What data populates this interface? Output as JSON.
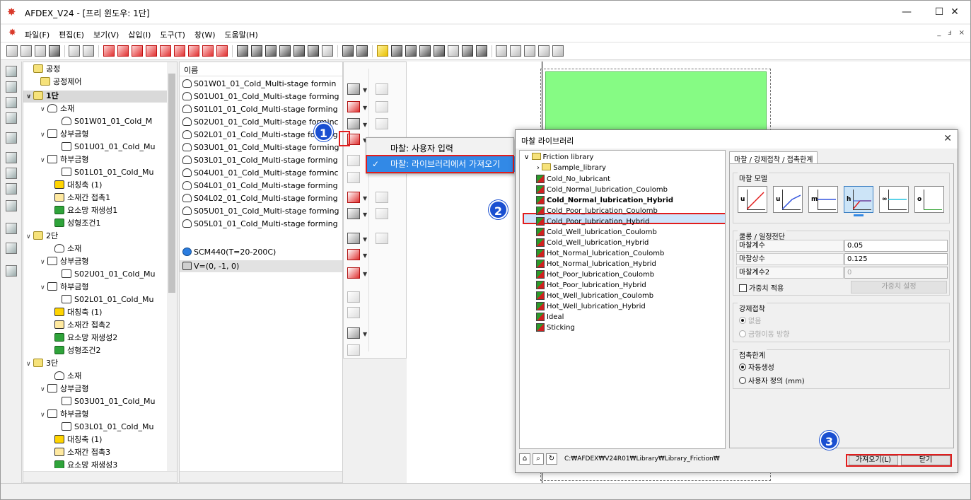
{
  "window": {
    "title": "AFDEX_V24 - [프리 윈도우: 1단]",
    "minimize": "—",
    "maximize": "☐",
    "close": "✕"
  },
  "menu": {
    "items": [
      "파일(F)",
      "편집(E)",
      "보기(V)",
      "삽입(I)",
      "도구(T)",
      "창(W)",
      "도움말(H)"
    ],
    "mdi": [
      "_",
      "ⅎ",
      "×"
    ]
  },
  "tree": {
    "nodes": [
      {
        "chev": "",
        "icon": "folder",
        "label": "공정"
      },
      {
        "chev": "",
        "icon": "folder",
        "label": "공정제어"
      },
      {
        "chev": "∨",
        "icon": "folder",
        "label": "1단"
      },
      {
        "chev": "∨",
        "icon": "part",
        "label": "소재"
      },
      {
        "chev": "",
        "icon": "part",
        "label": "S01W01_01_Cold_M"
      },
      {
        "chev": "∨",
        "icon": "die",
        "label": "상부금형"
      },
      {
        "chev": "",
        "icon": "die",
        "label": "S01U01_01_Cold_Mu"
      },
      {
        "chev": "∨",
        "icon": "die",
        "label": "하부금형"
      },
      {
        "chev": "",
        "icon": "die",
        "label": "S01L01_01_Cold_Mu"
      },
      {
        "chev": "",
        "icon": "axis",
        "label": "대칭축 (1)"
      },
      {
        "chev": "",
        "icon": "contact",
        "label": "소재간 접촉1"
      },
      {
        "chev": "",
        "icon": "green",
        "label": "요소망 재생성1"
      },
      {
        "chev": "",
        "icon": "green",
        "label": "성형조건1"
      },
      {
        "chev": "∨",
        "icon": "folder",
        "label": "2단"
      },
      {
        "chev": "",
        "icon": "part",
        "label": "소재"
      },
      {
        "chev": "∨",
        "icon": "die",
        "label": "상부금형"
      },
      {
        "chev": "",
        "icon": "die",
        "label": "S02U01_01_Cold_Mu"
      },
      {
        "chev": "∨",
        "icon": "die",
        "label": "하부금형"
      },
      {
        "chev": "",
        "icon": "die",
        "label": "S02L01_01_Cold_Mu"
      },
      {
        "chev": "",
        "icon": "axis",
        "label": "대칭축 (1)"
      },
      {
        "chev": "",
        "icon": "contact",
        "label": "소재간 접촉2"
      },
      {
        "chev": "",
        "icon": "green",
        "label": "요소망 재생성2"
      },
      {
        "chev": "",
        "icon": "green",
        "label": "성형조건2"
      },
      {
        "chev": "∨",
        "icon": "folder",
        "label": "3단"
      },
      {
        "chev": "",
        "icon": "part",
        "label": "소재"
      },
      {
        "chev": "∨",
        "icon": "die",
        "label": "상부금형"
      },
      {
        "chev": "",
        "icon": "die",
        "label": "S03U01_01_Cold_Mu"
      },
      {
        "chev": "∨",
        "icon": "die",
        "label": "하부금형"
      },
      {
        "chev": "",
        "icon": "die",
        "label": "S03L01_01_Cold_Mu"
      },
      {
        "chev": "",
        "icon": "axis",
        "label": "대칭축 (1)"
      },
      {
        "chev": "",
        "icon": "contact",
        "label": "소재간 접촉3"
      },
      {
        "chev": "",
        "icon": "green",
        "label": "요소망 재생성3"
      }
    ]
  },
  "list": {
    "header": "이름",
    "items": [
      {
        "icon": "part",
        "label": "S01W01_01_Cold_Multi-stage formin"
      },
      {
        "icon": "part",
        "label": "S01U01_01_Cold_Multi-stage forming"
      },
      {
        "icon": "part",
        "label": "S01L01_01_Cold_Multi-stage forming"
      },
      {
        "icon": "part",
        "label": "S02U01_01_Cold_Multi-stage forminc"
      },
      {
        "icon": "part",
        "label": "S02L01_01_Cold_Multi-stage forming"
      },
      {
        "icon": "part",
        "label": "S03U01_01_Cold_Multi-stage forming"
      },
      {
        "icon": "part",
        "label": "S03L01_01_Cold_Multi-stage forming"
      },
      {
        "icon": "part",
        "label": "S04U01_01_Cold_Multi-stage forminc"
      },
      {
        "icon": "part",
        "label": "S04L01_01_Cold_Multi-stage forming"
      },
      {
        "icon": "part",
        "label": "S04L02_01_Cold_Multi-stage forming"
      },
      {
        "icon": "part",
        "label": "S05U01_01_Cold_Multi-stage forming"
      },
      {
        "icon": "part",
        "label": "S05L01_01_Cold_Multi-stage forming"
      },
      {
        "icon": "mat",
        "label": "SCM440(T=20-200C)"
      },
      {
        "icon": "vel",
        "label": "V=(0, -1, 0)"
      }
    ]
  },
  "context_menu": {
    "item1": "마찰: 사용자 입력",
    "item2": "마찰: 라이브러리에서 가져오기",
    "check": "✓"
  },
  "dialog": {
    "title": "마찰 라이브러리",
    "close": "✕",
    "root": "Friction library",
    "sub": "Sample_library",
    "items": [
      "Cold_No_lubricant",
      "Cold_Normal_lubrication_Coulomb",
      "Cold_Normal_lubrication_Hybrid",
      "Cold_Poor_lubrication_Coulomb",
      "Cold_Poor_lubrication_Hybrid",
      "Cold_Well_lubrication_Coulomb",
      "Cold_Well_lubrication_Hybrid",
      "Hot_Normal_lubrication_Coulomb",
      "Hot_Normal_lubrication_Hybrid",
      "Hot_Poor_lubrication_Coulomb",
      "Hot_Poor_lubrication_Hybrid",
      "Hot_Well_lubrication_Coulomb",
      "Hot_Well_lubrication_Hybrid",
      "Ideal",
      "Sticking"
    ],
    "path": "C:₩AFDEX₩V24R01₩Library₩Library_Friction₩",
    "tab": "마찰 / 강제접착 / 접촉한계",
    "model_group": "마찰 모델",
    "model_labels": [
      "u",
      "u",
      "m",
      "h",
      "∞",
      "o"
    ],
    "coulomb_group": "쿨롱 / 일정전단",
    "fields": [
      {
        "label": "마찰계수",
        "value": "0.05"
      },
      {
        "label": "마찰상수",
        "value": "0.125"
      },
      {
        "label": "마찰계수2",
        "value": "0"
      }
    ],
    "weight_check": "가중치 적용",
    "weight_btn": "가중치 설정",
    "force_group": "강제접착",
    "force_opts": [
      "없음",
      "금형이동 방향"
    ],
    "limit_group": "접촉한계",
    "limit_opts": [
      "자동생성",
      "사용자 정의 (mm)"
    ],
    "import_btn": "가져오기(L)",
    "close_btn": "닫기"
  },
  "callouts": [
    "1",
    "2",
    "3"
  ]
}
